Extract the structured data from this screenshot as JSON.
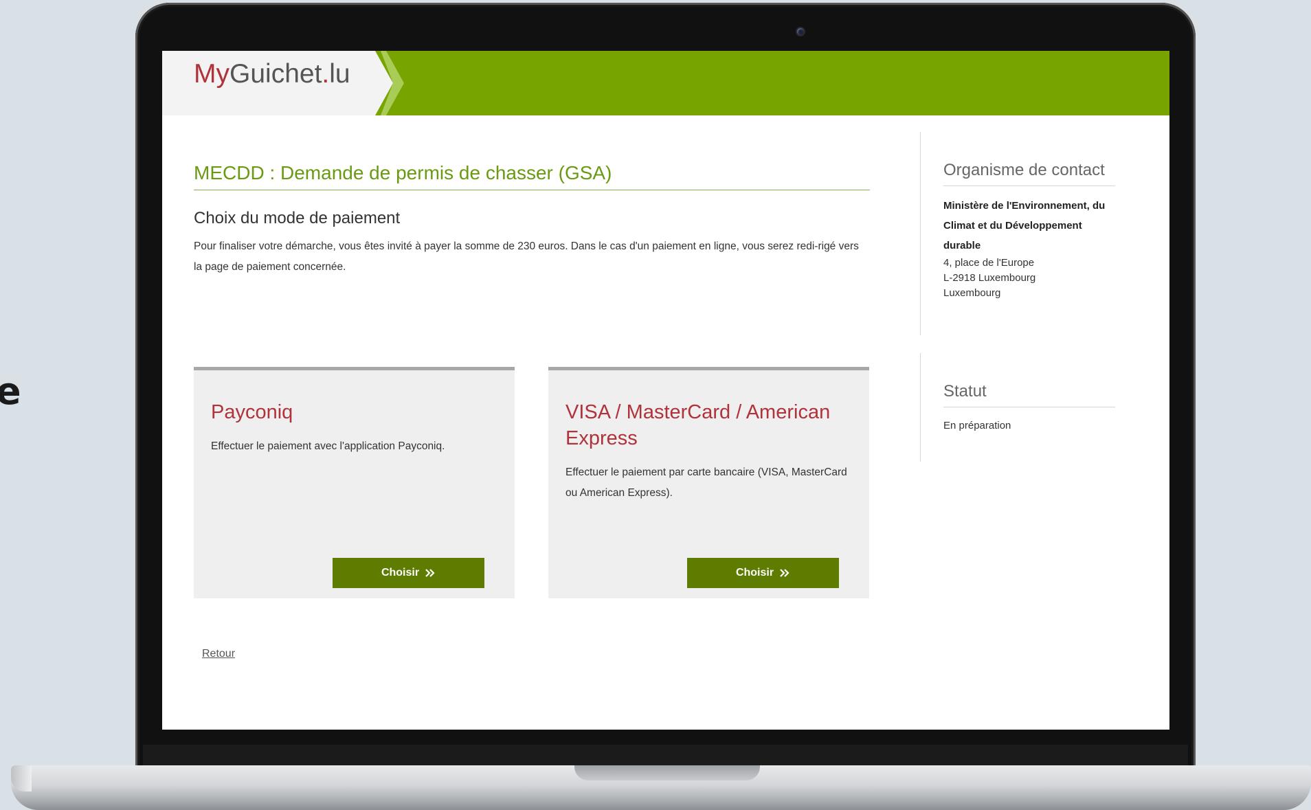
{
  "side_partial_text": "e",
  "site": {
    "logo_my": "My",
    "logo_guichet": "Guichet",
    "logo_dot": ".",
    "logo_lu": "lu",
    "brand_color": "#78a400",
    "accent_red": "#b0323a"
  },
  "main": {
    "title": "MECDD : Demande de permis de chasser (GSA)",
    "section_title": "Choix du mode de paiement",
    "intro": "Pour finaliser votre démarche, vous êtes invité à payer la somme de 230 euros. Dans le cas d'un paiement en ligne, vous serez redi-rigé vers la page de paiement concernée.",
    "cards": [
      {
        "title": "Payconiq",
        "description": "Effectuer le paiement avec l'application Payconiq.",
        "button": "Choisir",
        "button_icon": "double-chevron-right-icon"
      },
      {
        "title": "VISA / MasterCard / American Express",
        "description": "Effectuer le paiement par carte bancaire (VISA, MasterCard ou American Express).",
        "button": "Choisir",
        "button_icon": "double-chevron-right-icon"
      }
    ],
    "back_link": "Retour"
  },
  "sidebar": {
    "contact_title": "Organisme de contact",
    "org_name": "Ministère de l'Environnement, du Climat et du Développement durable",
    "address_line1": "4, place de l'Europe",
    "address_line2": "L-2918 Luxembourg",
    "address_line3": "Luxembourg",
    "status_title": "Statut",
    "status_value": "En préparation"
  }
}
